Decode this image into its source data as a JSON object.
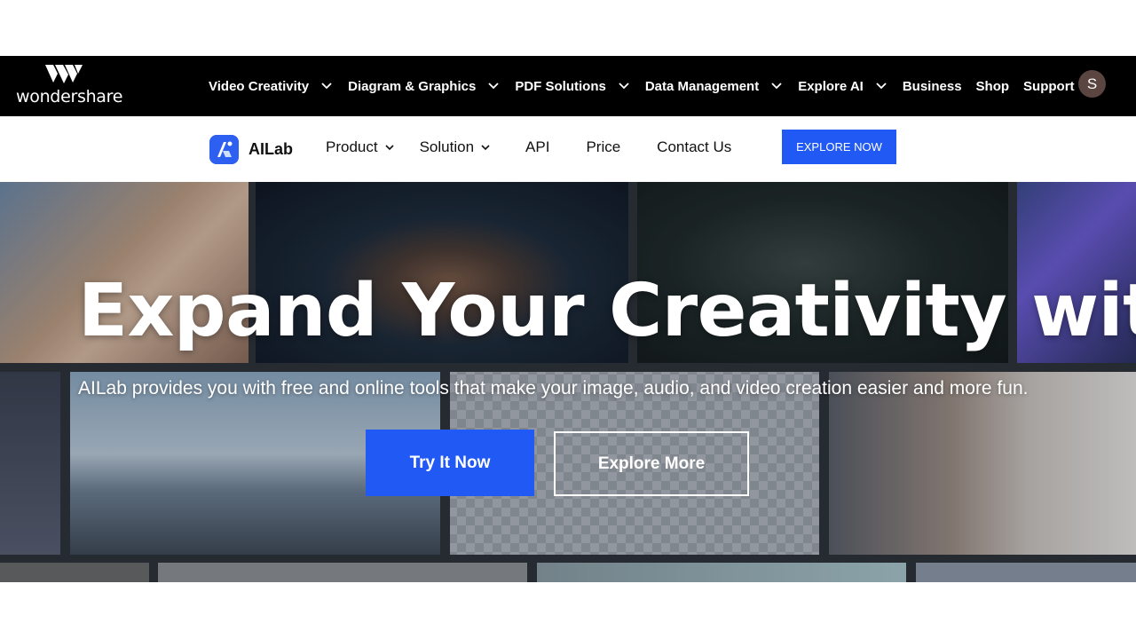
{
  "brand": {
    "name": "wondershare",
    "logo_icon": "wondershare-mark-icon"
  },
  "topnav": {
    "items": [
      {
        "label": "Video Creativity",
        "dropdown": true
      },
      {
        "label": "Diagram & Graphics",
        "dropdown": true
      },
      {
        "label": "PDF Solutions",
        "dropdown": true
      },
      {
        "label": "Data Management",
        "dropdown": true
      },
      {
        "label": "Explore AI",
        "dropdown": true
      },
      {
        "label": "Business",
        "dropdown": false
      },
      {
        "label": "Shop",
        "dropdown": false
      },
      {
        "label": "Support",
        "dropdown": false
      }
    ],
    "avatar_initial": "S"
  },
  "subnav": {
    "product_name": "AILab",
    "links": [
      {
        "label": "Product",
        "dropdown": true
      },
      {
        "label": "Solution",
        "dropdown": true
      },
      {
        "label": "API",
        "dropdown": false
      },
      {
        "label": "Price",
        "dropdown": false
      },
      {
        "label": "Contact Us",
        "dropdown": false
      }
    ],
    "cta_label": "EXPLORE NOW"
  },
  "hero": {
    "title": "Expand Your Creativity with AI",
    "subtitle": "AILab provides you with free and online tools that make your image, audio, and video creation easier and more fun.",
    "primary_button": "Try It Now",
    "secondary_button": "Explore More"
  },
  "colors": {
    "topbar_bg": "#000000",
    "accent": "#2159f4",
    "text_dark": "#111111"
  }
}
